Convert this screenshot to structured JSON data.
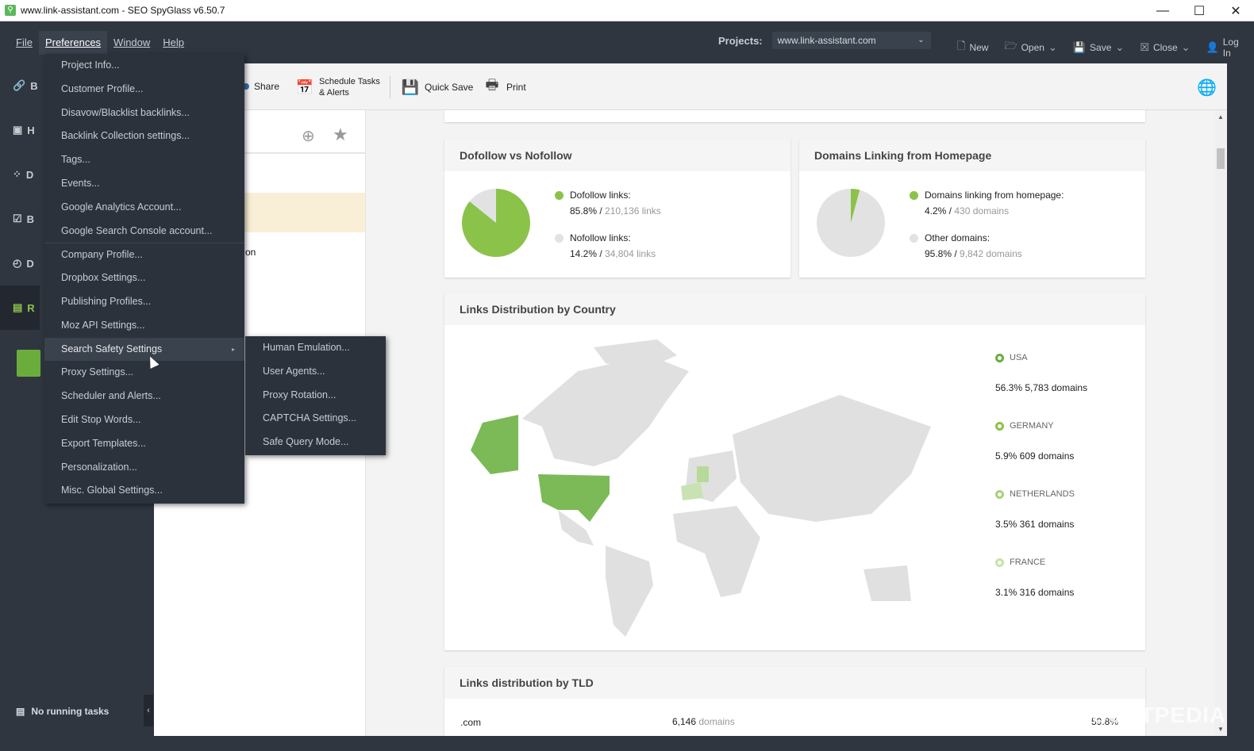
{
  "window": {
    "title": "www.link-assistant.com - SEO SpyGlass v6.50.7",
    "minimize": "—",
    "maximize": "☐",
    "close": "✕"
  },
  "menubar": {
    "items": [
      "File",
      "Preferences",
      "Window",
      "Help"
    ]
  },
  "projects": {
    "label": "Projects:",
    "selected": "www.link-assistant.com"
  },
  "top_actions": {
    "new": "New",
    "open": "Open",
    "save": "Save",
    "close": "Close",
    "login": "Log In"
  },
  "sidebar": {
    "items": [
      "B",
      "H",
      "D",
      "B",
      "D",
      "R"
    ]
  },
  "toolbar": {
    "share": "Share",
    "schedule_line1": "Schedule Tasks",
    "schedule_line2": "& Alerts",
    "quick_save": "Quick Save",
    "print": "Print"
  },
  "panel": {
    "partial_text": "on"
  },
  "status": {
    "no_running_tasks": "No running tasks"
  },
  "preferences_menu": {
    "items": [
      "Project Info...",
      "Customer Profile...",
      "Disavow/Blacklist backlinks...",
      "Backlink Collection settings...",
      "Tags...",
      "Events...",
      "Google Analytics Account...",
      "Google Search Console account...",
      "Company Profile...",
      "Dropbox Settings...",
      "Publishing Profiles...",
      "Moz API Settings...",
      "Search Safety Settings",
      "Proxy Settings...",
      "Scheduler and Alerts...",
      "Edit Stop Words...",
      "Export Templates...",
      "Personalization...",
      "Misc. Global Settings..."
    ]
  },
  "search_safety_submenu": {
    "items": [
      "Human Emulation...",
      "User Agents...",
      "Proxy Rotation...",
      "CAPTCHA Settings...",
      "Safe Query Mode..."
    ]
  },
  "cards": {
    "dofollow": {
      "title": "Dofollow vs Nofollow",
      "dofollow_label": "Dofollow links:",
      "dofollow_pct": "85.8% /",
      "dofollow_count": "210,136 links",
      "nofollow_label": "Nofollow links:",
      "nofollow_pct": "14.2% /",
      "nofollow_count": "34,804 links",
      "dofollow_share": 0.858
    },
    "homepage": {
      "title": "Domains Linking from Homepage",
      "home_label": "Domains linking from homepage:",
      "home_pct": "4.2% /",
      "home_count": "430 domains",
      "other_label": "Other domains:",
      "other_pct": "95.8% /",
      "other_count": "9,842 domains",
      "home_share": 0.042
    },
    "country": {
      "title": "Links Distribution by Country",
      "countries": [
        {
          "name": "USA",
          "value": "56.3% 5,783 domains"
        },
        {
          "name": "GERMANY",
          "value": "5.9% 609 domains"
        },
        {
          "name": "NETHERLANDS",
          "value": "3.5% 361 domains"
        },
        {
          "name": "FRANCE",
          "value": "3.1% 316 domains"
        }
      ]
    },
    "tld": {
      "title": "Links distribution by TLD",
      "tld": ".com",
      "count": "6,146",
      "unit": "domains",
      "pct": "59.8%"
    }
  },
  "colors": {
    "green": "#8bc34a",
    "light_green": "#a5d37a",
    "grey": "#e2e2e2",
    "dark_bg": "#2f3640"
  },
  "watermark": "SOFTPEDIA"
}
